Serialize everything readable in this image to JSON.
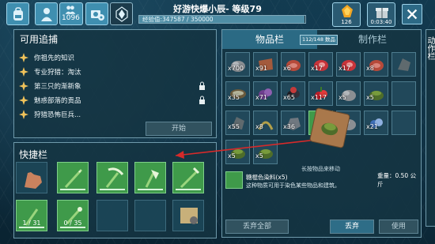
{
  "topbar": {
    "level": "1096",
    "title": "好游快爆小辰- 等级79",
    "xp_label": "经验值:347587 / 350000",
    "xp_fraction": 0.993,
    "resource_amber": "126",
    "resource_gift_timer": "0:03:40"
  },
  "tracking": {
    "title": "可用追捕",
    "items": [
      {
        "label": "你祖先的知识",
        "locked": false
      },
      {
        "label": "专业狩猎：淘汰",
        "locked": false
      },
      {
        "label": "第三只的渐新象",
        "locked": true
      },
      {
        "label": "魅惑部落的贡品",
        "locked": true
      },
      {
        "label": "狩猎恐怖巨兵...",
        "locked": false
      }
    ],
    "start_label": "开始"
  },
  "hotbar": {
    "title": "快捷栏",
    "slots": [
      {
        "icon": "hand-icon",
        "count": "",
        "green": false
      },
      {
        "icon": "spear-icon",
        "count": "",
        "green": true
      },
      {
        "icon": "pickaxe-icon",
        "count": "",
        "green": true
      },
      {
        "icon": "hatchet-icon",
        "count": "",
        "green": true
      },
      {
        "icon": "bow-icon",
        "count": "",
        "green": true
      },
      {
        "icon": "torch-icon",
        "count": "1 / 31",
        "green": true
      },
      {
        "icon": "bola-icon",
        "count": "0 / 35",
        "green": true
      },
      {
        "icon": "empty",
        "count": "",
        "green": false
      },
      {
        "icon": "empty",
        "count": "",
        "green": false
      },
      {
        "icon": "map-icon",
        "count": "",
        "green": false
      }
    ]
  },
  "inventory": {
    "tab_active": "物品栏",
    "tab_inactive": "制作栏",
    "capacity": "112/148 数品",
    "grid": [
      {
        "q": "x700",
        "icon": "stone-icon"
      },
      {
        "q": "x91",
        "icon": "leather-icon"
      },
      {
        "q": "x6",
        "icon": "meat-icon"
      },
      {
        "q": "x17",
        "icon": "raw-meat-icon"
      },
      {
        "q": "x17",
        "icon": "raw-meat-icon"
      },
      {
        "q": "x8",
        "icon": "meat-icon"
      },
      {
        "q": "",
        "icon": "flint-icon"
      },
      {
        "q": "x35",
        "icon": "bowl-icon"
      },
      {
        "q": "x71",
        "icon": "berry-purple-icon"
      },
      {
        "q": "x65",
        "icon": "berry-black-icon"
      },
      {
        "q": "x117",
        "icon": "berry-red-icon"
      },
      {
        "q": "x5",
        "icon": "stone-icon"
      },
      {
        "q": "x5",
        "icon": "dye-icon"
      },
      {
        "q": "",
        "icon": "empty"
      },
      {
        "q": "x55",
        "icon": "flint-icon"
      },
      {
        "q": "x8",
        "icon": "fiber-icon"
      },
      {
        "q": "x36",
        "icon": "rock-icon"
      },
      {
        "q": "",
        "icon": "empty"
      },
      {
        "q": "x5",
        "icon": "stone-icon"
      },
      {
        "q": "x21",
        "icon": "berry-blue-icon"
      },
      {
        "q": "",
        "icon": "empty"
      },
      {
        "q": "x5",
        "icon": "dye-icon"
      },
      {
        "q": "x5",
        "icon": "dye-icon"
      }
    ],
    "hint": "长按物品来移动",
    "detail_name": "糖棍色染料(x5)",
    "detail_weight": "重量：0.50 公斤",
    "detail_desc": "这种物质可用于染色某些物品和建筑。",
    "discard_all_label": "丢弃全部",
    "discard_label": "丢弃",
    "use_label": "使用"
  },
  "side_tab": "动作栏"
}
